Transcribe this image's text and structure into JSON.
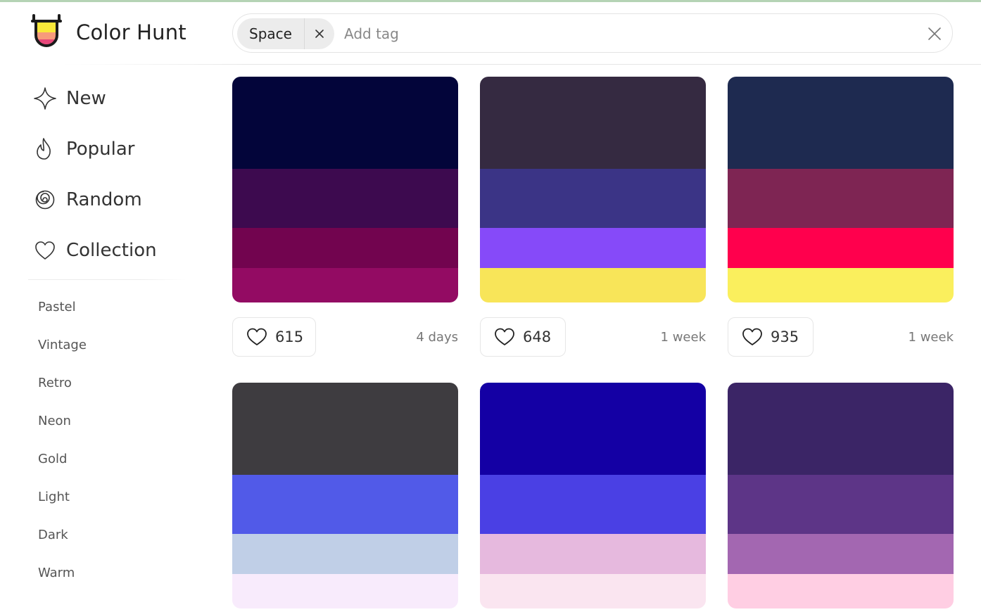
{
  "app": {
    "name": "Color Hunt"
  },
  "search": {
    "chips": [
      {
        "label": "Space"
      }
    ],
    "placeholder": "Add tag",
    "value": ""
  },
  "sidebar": {
    "nav": [
      {
        "label": "New",
        "icon": "sparkle-icon"
      },
      {
        "label": "Popular",
        "icon": "flame-icon"
      },
      {
        "label": "Random",
        "icon": "spiral-icon"
      },
      {
        "label": "Collection",
        "icon": "heart-icon"
      }
    ],
    "tags": [
      "Pastel",
      "Vintage",
      "Retro",
      "Neon",
      "Gold",
      "Light",
      "Dark",
      "Warm"
    ]
  },
  "palettes": [
    {
      "colors": [
        "#03053a",
        "#3d0a4f",
        "#72044f",
        "#930b63"
      ],
      "likes": "615",
      "age": "4 days"
    },
    {
      "colors": [
        "#352a41",
        "#3b3486",
        "#864af9",
        "#f8e559"
      ],
      "likes": "648",
      "age": "1 week"
    },
    {
      "colors": [
        "#1e2a50",
        "#7e2553",
        "#ff004d",
        "#faef5d"
      ],
      "likes": "935",
      "age": "1 week"
    },
    {
      "colors": [
        "#3e3c40",
        "#515ae8",
        "#c0cfe7",
        "#f8ebfc"
      ],
      "likes": "",
      "age": ""
    },
    {
      "colors": [
        "#1400a4",
        "#4a40e4",
        "#e6b9de",
        "#fae5f0"
      ],
      "likes": "",
      "age": ""
    },
    {
      "colors": [
        "#3b2566",
        "#5d3587",
        "#a367b1",
        "#ffcee3"
      ],
      "likes": "",
      "age": ""
    }
  ]
}
